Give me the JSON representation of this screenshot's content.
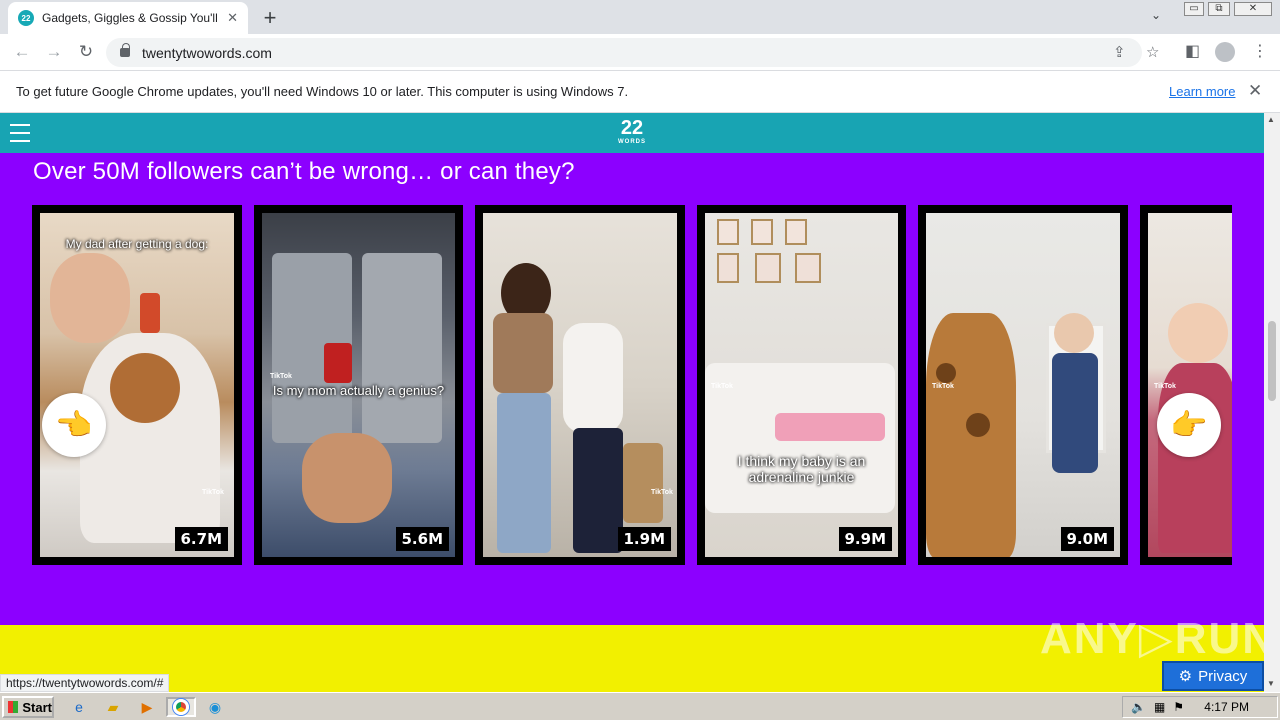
{
  "browser": {
    "tab_title": "Gadgets, Giggles & Gossip You'll Love",
    "tab_favicon": "22",
    "new_tab_label": "+",
    "url": "twentytwowords.com",
    "window_buttons": [
      "▭",
      "⧉",
      "✕"
    ]
  },
  "infobar": {
    "message": "To get future Google Chrome updates, you'll need Windows 10 or later. This computer is using Windows 7.",
    "link": "Learn more"
  },
  "site": {
    "logo_number": "22",
    "logo_word": "WORDS",
    "section_title": "Over 50M followers can’t be wrong… or can they?",
    "cards": [
      {
        "caption": "My dad after getting a dog:",
        "views": "6.7M"
      },
      {
        "caption": "Is my mom actually a genius?",
        "views": "5.6M"
      },
      {
        "caption": "",
        "views": "1.9M"
      },
      {
        "caption": "I think my baby is an adrenaline junkie",
        "views": "9.9M"
      },
      {
        "caption": "",
        "views": "9.0M"
      },
      {
        "caption": "",
        "views": ""
      }
    ],
    "tiktok_label": "TikTok",
    "prev_arrow": "👈",
    "next_arrow": "👉",
    "watermark": "ANY▷RUN",
    "privacy_label": "Privacy",
    "status_url": "https://twentytwowords.com/#"
  },
  "taskbar": {
    "start_label": "Start",
    "clock": "4:17 PM"
  },
  "colors": {
    "header_teal": "#18a4b3",
    "purple": "#8c00ff",
    "yellow": "#f2f000",
    "privacy_blue": "#1e6fd9"
  }
}
